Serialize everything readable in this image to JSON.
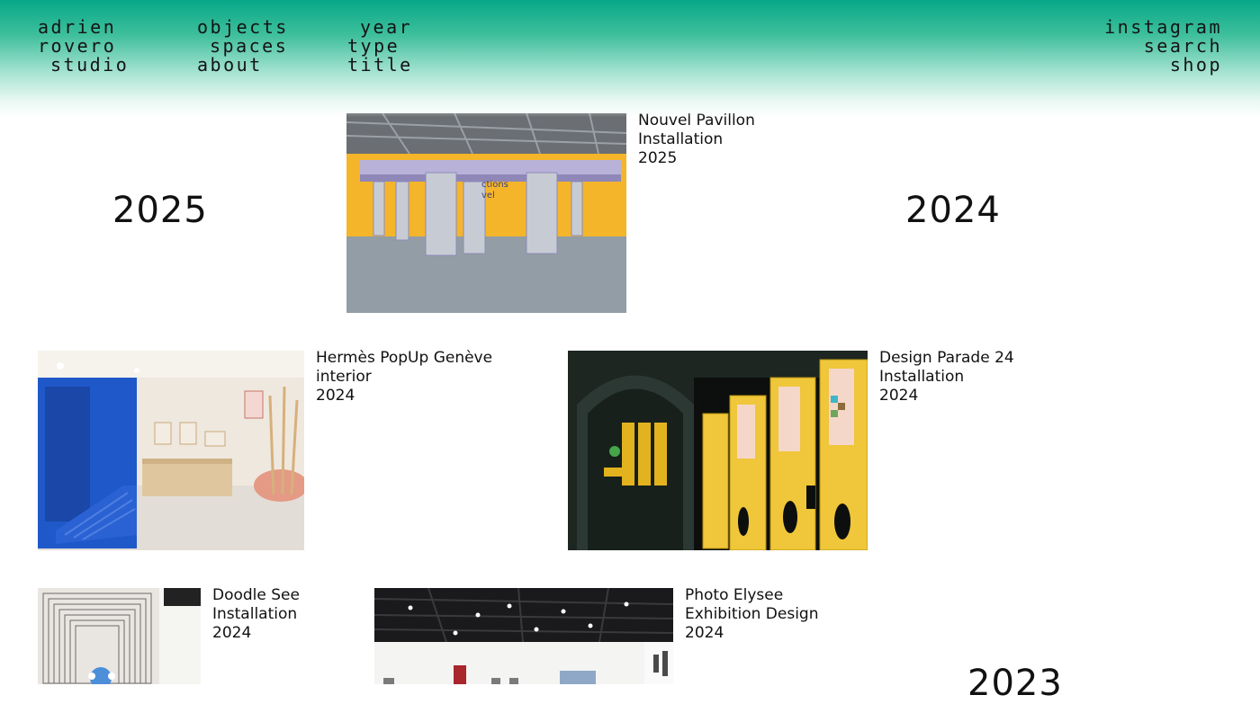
{
  "brand": {
    "line1": "adrien",
    "line2": "rovero",
    "line3": "studio"
  },
  "nav": {
    "objects": "objects",
    "spaces": "spaces",
    "about": "about",
    "year": "year",
    "type": "type",
    "title": "title",
    "instagram": "instagram",
    "search": "search",
    "shop": "shop"
  },
  "years": {
    "y2025": "2025",
    "y2024": "2024",
    "y2023": "2023"
  },
  "projects": [
    {
      "title": "Nouvel Pavillon",
      "type": "Installation",
      "year": "2025"
    },
    {
      "title": "Hermès PopUp Genève",
      "type": "interior",
      "year": "2024"
    },
    {
      "title": "Design Parade 24",
      "type": "Installation",
      "year": "2024"
    },
    {
      "title": "Doodle See",
      "type": "Installation",
      "year": "2024"
    },
    {
      "title": "Photo Elysee",
      "type": "Exhibition Design",
      "year": "2024"
    }
  ],
  "images": {
    "nouvel": "nouvel-pavillon-photo",
    "hermes": "hermes-popup-photo",
    "parade": "design-parade-photo",
    "doodle": "doodle-see-photo",
    "elysee": "photo-elysee-photo"
  },
  "colors": {
    "header_accent": "#06a887",
    "text": "#111111"
  }
}
